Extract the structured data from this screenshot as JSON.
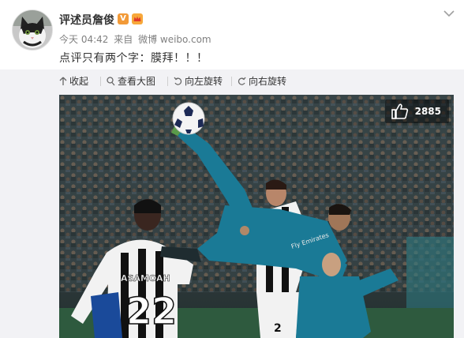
{
  "post": {
    "user_name": "评述员詹俊",
    "verified_badge": "V",
    "time": "今天 04:42",
    "source_prefix": "来自",
    "source": "微博 weibo.com",
    "text": "点评只有两个字：膜拜！！！"
  },
  "toolbar": {
    "collapse": "收起",
    "view_large": "查看大图",
    "rotate_left": "向左旋转",
    "rotate_right": "向右旋转"
  },
  "photo": {
    "like_count": "2885",
    "jersey_name": "ASAMOAH",
    "jersey_number": "22",
    "shirt_sponsor": "Fly Emirates",
    "shorts_number": "2"
  },
  "colors": {
    "accent": "#f29a38",
    "panel_bg": "#f2f2f5",
    "real_teal": "#1a7a96"
  },
  "icons": {
    "collapse": "arrow-up-icon",
    "view_large": "magnifier-icon",
    "rotate_left": "rotate-left-icon",
    "rotate_right": "rotate-right-icon",
    "like": "thumbs-up-icon",
    "more": "chevron-down-icon"
  }
}
